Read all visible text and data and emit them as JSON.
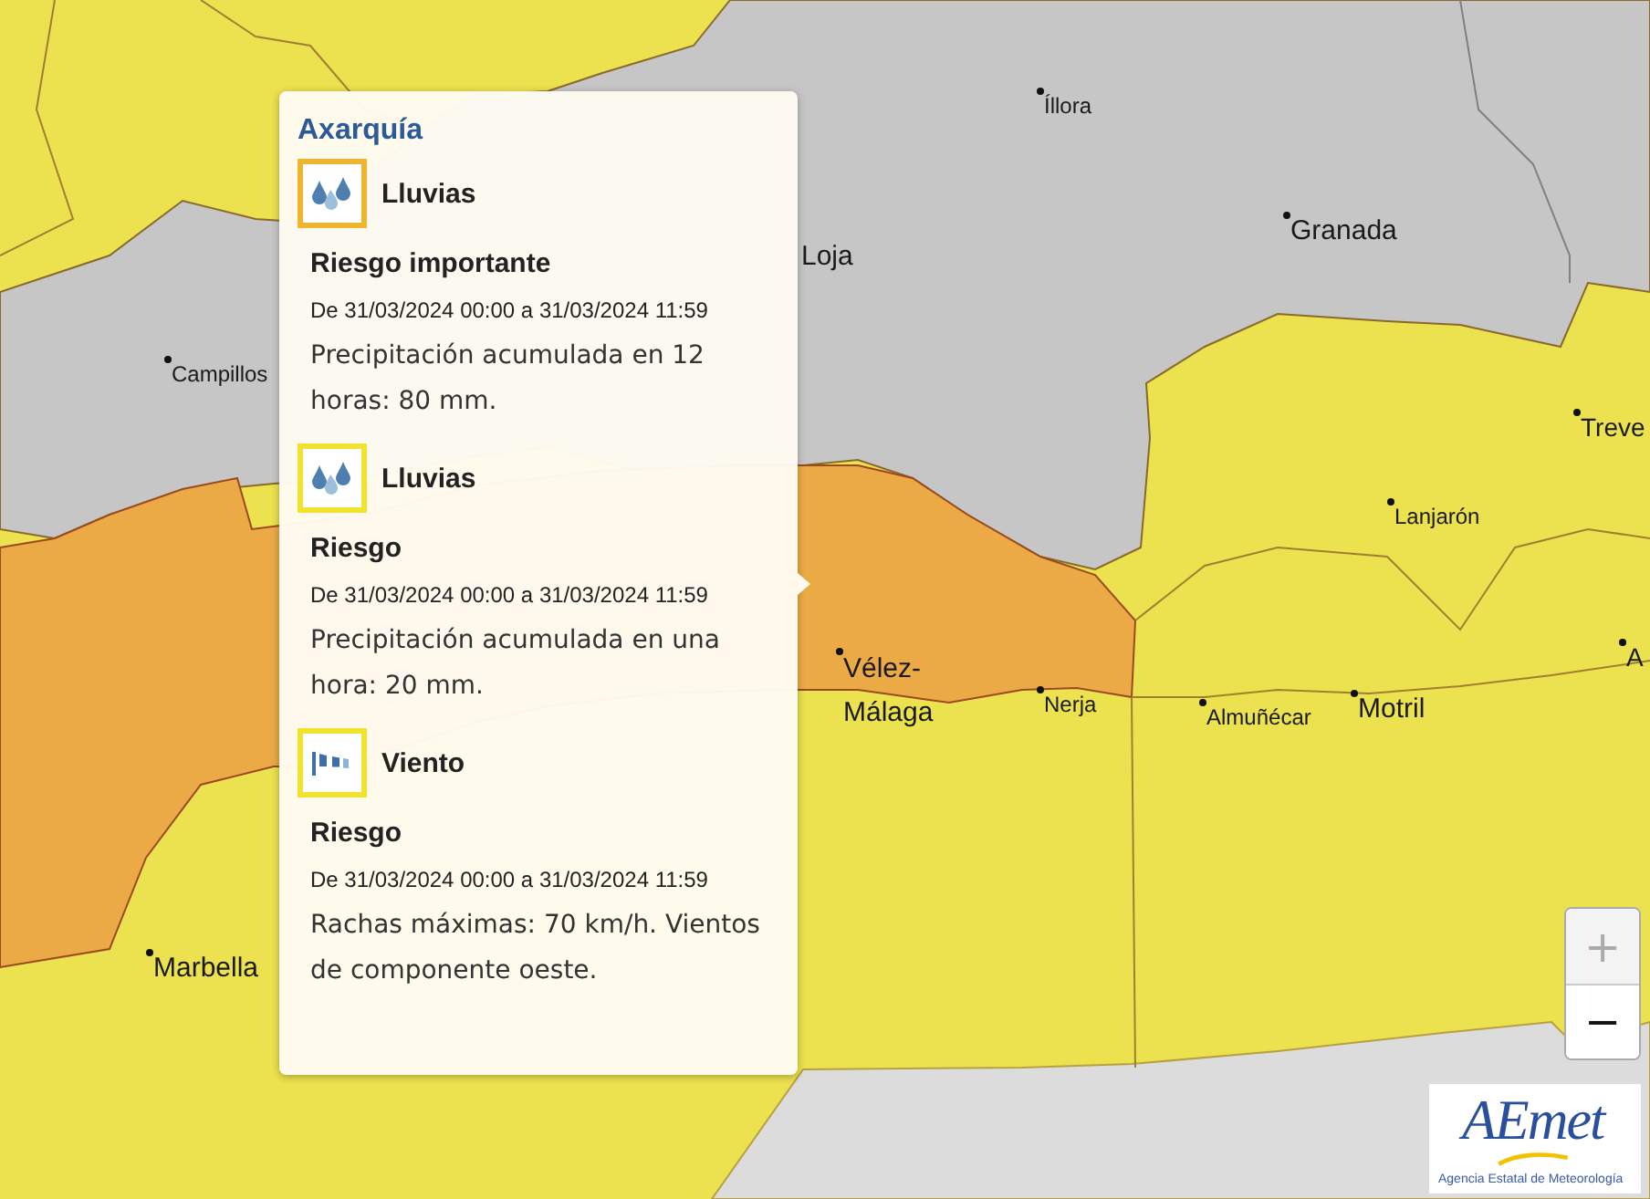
{
  "map": {
    "places": [
      {
        "name": "Íllora",
        "kind": "town"
      },
      {
        "name": "Granada",
        "kind": "city"
      },
      {
        "name": "Loja",
        "kind": "city"
      },
      {
        "name": "Campillos",
        "kind": "town"
      },
      {
        "name": "Treve",
        "kind": "city"
      },
      {
        "name": "Lanjarón",
        "kind": "town"
      },
      {
        "name": "A",
        "kind": "city"
      },
      {
        "name": "Vélez-Málaga",
        "kind": "city"
      },
      {
        "name": "Nerja",
        "kind": "town"
      },
      {
        "name": "Almuñécar",
        "kind": "town"
      },
      {
        "name": "Motril",
        "kind": "city"
      },
      {
        "name": "Marbella",
        "kind": "city"
      }
    ]
  },
  "popup": {
    "title": "Axarquía",
    "warnings": [
      {
        "phenomenon": "Lluvias",
        "kind": "rain",
        "color": "#f0b52f",
        "risk": "Riesgo importante",
        "period": "De 31/03/2024 00:00 a 31/03/2024 11:59",
        "description": "Precipitación acumulada en 12 horas: 80 mm."
      },
      {
        "phenomenon": "Lluvias",
        "kind": "rain",
        "color": "#f2e230",
        "risk": "Riesgo",
        "period": "De 31/03/2024 00:00 a 31/03/2024 11:59",
        "description": "Precipitación acumulada en una hora: 20 mm."
      },
      {
        "phenomenon": "Viento",
        "kind": "wind",
        "color": "#f2e230",
        "risk": "Riesgo",
        "period": "De 31/03/2024 00:00 a 31/03/2024 11:59",
        "description": "Rachas máximas: 70 km/h. Vientos de componente oeste."
      }
    ]
  },
  "zoom": {
    "buttons": [
      {
        "label": "+",
        "disabled": true
      },
      {
        "label": "−",
        "disabled": false
      }
    ]
  },
  "logo": {
    "wordmark": "AEmet",
    "caption": "Agencia Estatal de Meteorología"
  }
}
